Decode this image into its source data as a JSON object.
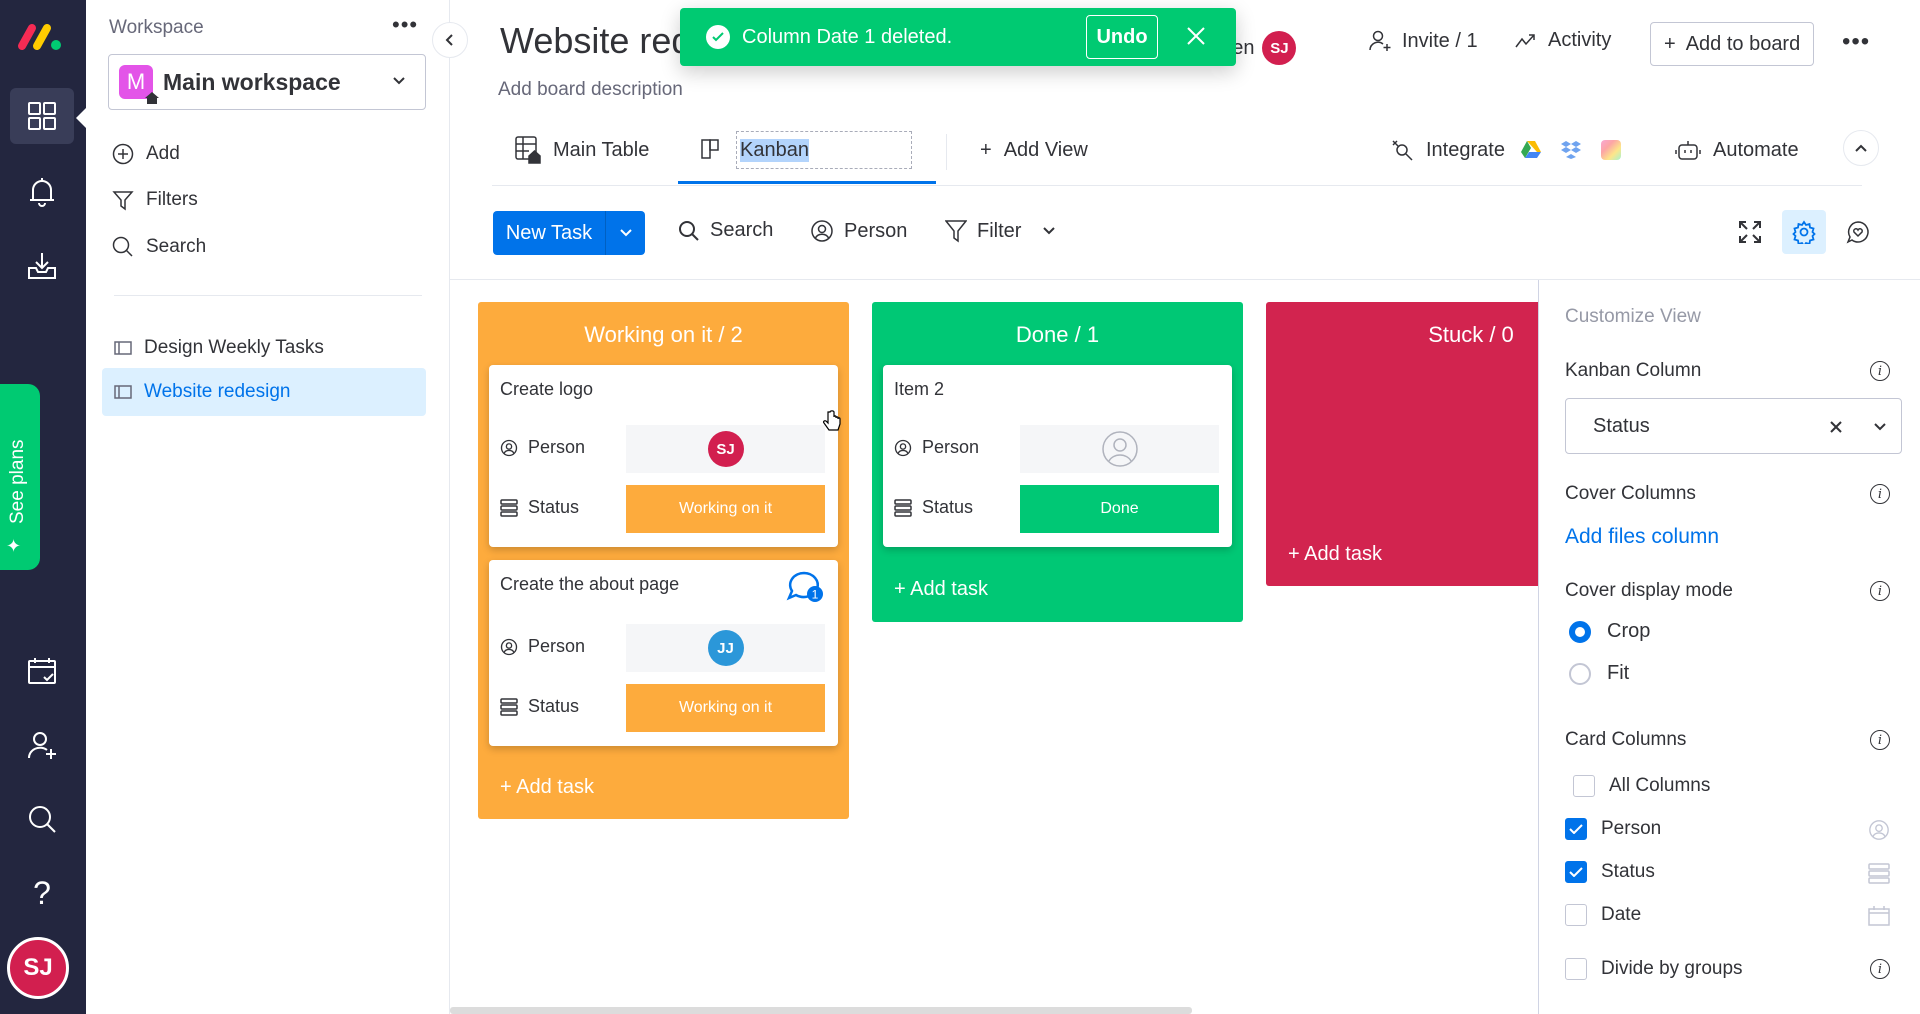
{
  "nav": {
    "items": [
      "workspaces",
      "notifications",
      "inbox",
      "my-work",
      "invite-members",
      "search",
      "help"
    ],
    "see_plans": "See plans",
    "user_initials": "SJ"
  },
  "workspace": {
    "label": "Workspace",
    "name": "Main workspace",
    "badge_letter": "M",
    "actions": {
      "add": "Add",
      "filters": "Filters",
      "search": "Search"
    },
    "boards": [
      {
        "name": "Design Weekly Tasks",
        "active": false
      },
      {
        "name": "Website redesign",
        "active": true
      }
    ]
  },
  "header": {
    "title": "Website redesign",
    "title_visible": "Website red",
    "description": "Add board description",
    "last_seen": "t seen",
    "last_seen_initials": "SJ",
    "invite": "Invite / 1",
    "activity": "Activity",
    "add_to_board": "Add to board"
  },
  "toast": {
    "message": "Column Date 1 deleted.",
    "undo": "Undo"
  },
  "tabs": {
    "main_table": "Main Table",
    "kanban": "Kanban",
    "add_view": "Add View",
    "integrate": "Integrate",
    "automate": "Automate"
  },
  "toolbar": {
    "new_task": "New Task",
    "search": "Search",
    "person": "Person",
    "filter": "Filter"
  },
  "kanban": {
    "columns": [
      {
        "title": "Working on it / 2",
        "color": "#fdab3d",
        "add_task": "+ Add task",
        "cards": [
          {
            "name": "Create logo",
            "person_label": "Person",
            "person": "SJ",
            "person_color": "#d21f4f",
            "status_label": "Status",
            "status": "Working on it",
            "status_color": "#fdab3d"
          },
          {
            "name": "Create the about page",
            "person_label": "Person",
            "person": "JJ",
            "person_color": "#2b97d9",
            "status_label": "Status",
            "status": "Working on it",
            "status_color": "#fdab3d",
            "comments": "1"
          }
        ]
      },
      {
        "title": "Done / 1",
        "color": "#00c875",
        "add_task": "+ Add task",
        "cards": [
          {
            "name": "Item 2",
            "person_label": "Person",
            "person": "",
            "status_label": "Status",
            "status": "Done",
            "status_color": "#00c875"
          }
        ]
      },
      {
        "title": "Stuck / 0",
        "color": "#df2f4a",
        "add_task": "+ Add task",
        "cards": []
      }
    ]
  },
  "customize": {
    "title": "Customize View",
    "kanban_column_label": "Kanban Column",
    "kanban_column_value": "Status",
    "cover_columns_label": "Cover Columns",
    "add_files_column": "Add files column",
    "cover_display_label": "Cover display mode",
    "display_modes": [
      {
        "label": "Crop",
        "selected": true
      },
      {
        "label": "Fit",
        "selected": false
      }
    ],
    "card_columns_label": "Card Columns",
    "all_columns": {
      "label": "All Columns",
      "checked": false
    },
    "columns": [
      {
        "label": "Person",
        "checked": true,
        "icon": "person-icon"
      },
      {
        "label": "Status",
        "checked": true,
        "icon": "status-icon"
      },
      {
        "label": "Date",
        "checked": false,
        "icon": "calendar-icon"
      }
    ],
    "divide_by_groups": {
      "label": "Divide by groups",
      "checked": false
    }
  }
}
